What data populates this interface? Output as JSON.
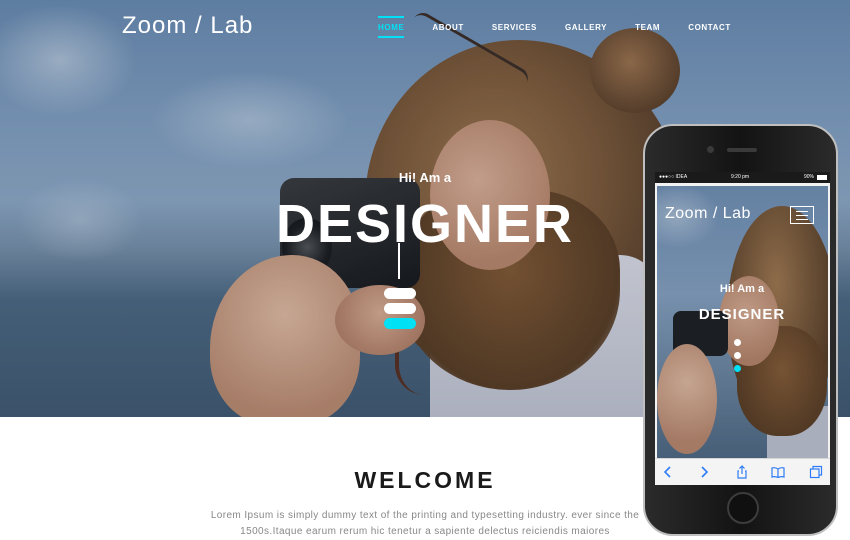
{
  "site": {
    "logo": "Zoom / Lab",
    "nav": [
      "HOME",
      "ABOUT",
      "SERVICES",
      "GALLERY",
      "TEAM",
      "CONTACT"
    ],
    "active_nav": "HOME"
  },
  "hero": {
    "greeting": "Hi! Am a",
    "headline": "DESIGNER",
    "slide_count": 3,
    "active_slide": 3
  },
  "welcome": {
    "title": "WELCOME",
    "text": "Lorem Ipsum is simply dummy text of the printing and typesetting industry. ever since the 1500s.Itaque earum rerum hic tenetur a sapiente delectus reiciendis maiores"
  },
  "phone": {
    "status": {
      "carrier": "●●●○○ IDEA",
      "time": "9:20 pm",
      "battery": "90%"
    },
    "logo": "Zoom / Lab",
    "greeting": "Hi! Am a",
    "headline": "DESIGNER",
    "toolbar_icons": [
      "back-icon",
      "forward-icon",
      "share-icon",
      "bookmarks-icon",
      "tabs-icon"
    ]
  },
  "colors": {
    "accent": "#00e1f5",
    "text_dark": "#1a1a1a",
    "text_muted": "#888888",
    "hero_text": "#ffffff"
  }
}
